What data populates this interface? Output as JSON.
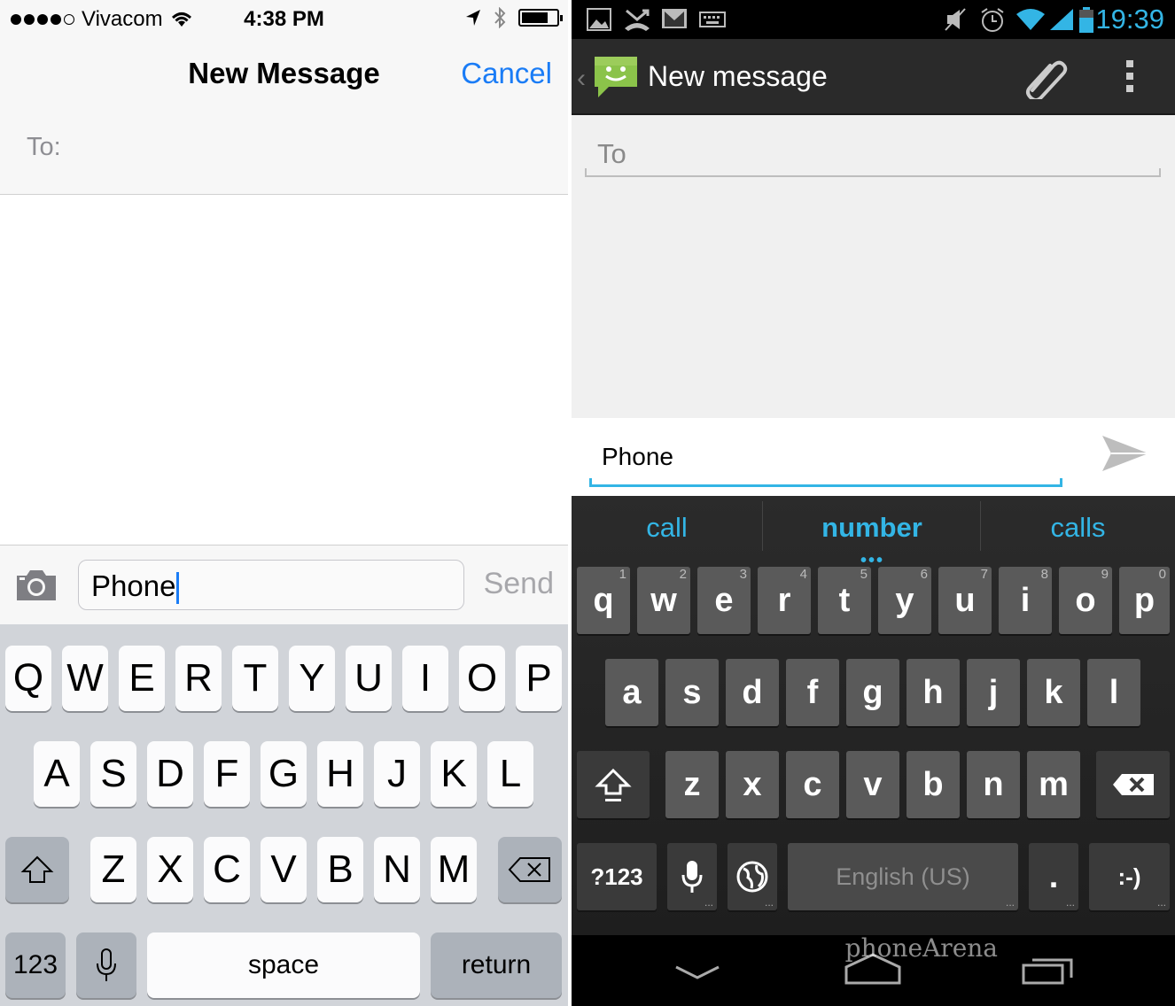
{
  "ios": {
    "status": {
      "carrier": "Vivacom",
      "time": "4:38 PM"
    },
    "nav": {
      "title": "New Message",
      "cancel": "Cancel"
    },
    "to_label": "To:",
    "compose": {
      "value": "Phone",
      "send": "Send"
    },
    "keyboard": {
      "row1": [
        "Q",
        "W",
        "E",
        "R",
        "T",
        "Y",
        "U",
        "I",
        "O",
        "P"
      ],
      "row2": [
        "A",
        "S",
        "D",
        "F",
        "G",
        "H",
        "J",
        "K",
        "L"
      ],
      "row3": [
        "Z",
        "X",
        "C",
        "V",
        "B",
        "N",
        "M"
      ],
      "numbers": "123",
      "space": "space",
      "return": "return"
    },
    "colors": {
      "accent": "#1a7cf6"
    }
  },
  "android": {
    "status": {
      "time": "19:39"
    },
    "action_bar": {
      "title": "New message"
    },
    "to_label": "To",
    "compose": {
      "value": "Phone"
    },
    "suggestions": [
      "call",
      "number",
      "calls"
    ],
    "keyboard": {
      "row1": [
        "q",
        "w",
        "e",
        "r",
        "t",
        "y",
        "u",
        "i",
        "o",
        "p"
      ],
      "row1_hints": [
        "1",
        "2",
        "3",
        "4",
        "5",
        "6",
        "7",
        "8",
        "9",
        "0"
      ],
      "row2": [
        "a",
        "s",
        "d",
        "f",
        "g",
        "h",
        "j",
        "k",
        "l"
      ],
      "row3": [
        "z",
        "x",
        "c",
        "v",
        "b",
        "n",
        "m"
      ],
      "symbols": "?123",
      "space": "English (US)",
      "period": ".",
      "emoticon": ":-)"
    },
    "watermark": "phoneArena",
    "colors": {
      "accent": "#33b5e5"
    }
  }
}
